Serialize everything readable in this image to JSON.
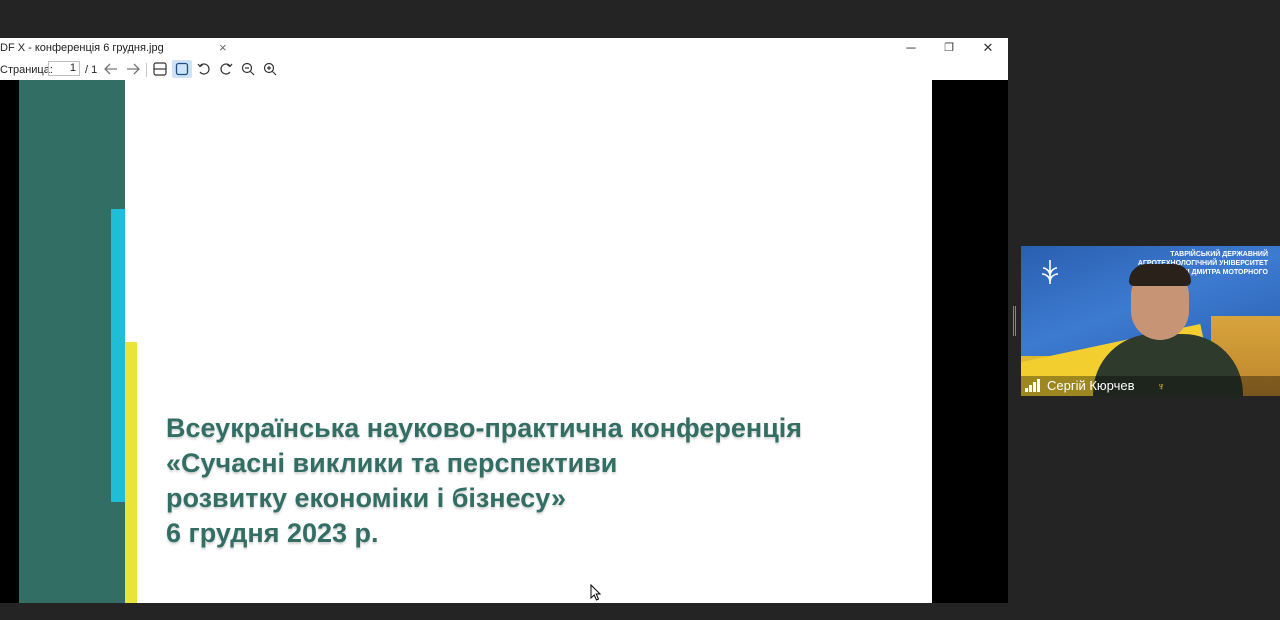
{
  "viewer": {
    "title": "DF X - конференція 6 грудня.jpg",
    "tab_close": "×",
    "window_buttons": {
      "minimize": "─",
      "maximize": "❐",
      "close": "✕"
    },
    "toolbar": {
      "page_label": "Страница:",
      "page_value": "1",
      "page_total": "/ 1",
      "icons": [
        "arrow-left-icon",
        "arrow-right-icon",
        "fit-width-icon",
        "fit-page-icon",
        "rotate-left-icon",
        "rotate-right-icon",
        "zoom-out-icon",
        "zoom-in-icon"
      ]
    }
  },
  "slide": {
    "line1": "Всеукраїнська науково-практична конференція",
    "line2": "«Сучасні виклики та перспективи",
    "line3": "розвитку економіки і бізнесу»",
    "line4": "6 грудня 2023 р.",
    "colors": {
      "green": "#336e64",
      "cyan": "#1ebfd6",
      "yellow": "#e8e43a"
    }
  },
  "video": {
    "org_line1": "ТАВРІЙСЬКИЙ ДЕРЖАВНИЙ",
    "org_line2": "АГРОТЕХНОЛОГІЧНИЙ УНІВЕРСИТЕТ",
    "org_line3": "ІМЕНІ ДМИТРА МОТОРНОГО",
    "participant_name": "Сергій Кюрчев"
  }
}
